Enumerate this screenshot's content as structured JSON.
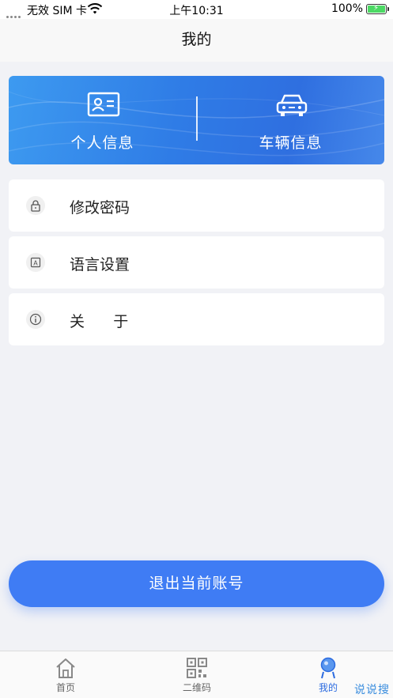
{
  "status_bar": {
    "carrier": "无效 SIM 卡",
    "time": "上午10:31",
    "battery": "100%"
  },
  "nav": {
    "title": "我的"
  },
  "hero": {
    "left_label": "个人信息",
    "right_label": "车辆信息"
  },
  "menu": [
    {
      "label": "修改密码",
      "icon": "lock-icon"
    },
    {
      "label": "语言设置",
      "icon": "language-icon"
    },
    {
      "label": "关      于",
      "icon": "info-icon"
    }
  ],
  "logout_label": "退出当前账号",
  "tabs": [
    {
      "label": "首页",
      "icon": "home-icon"
    },
    {
      "label": "二维码",
      "icon": "qrcode-icon"
    },
    {
      "label": "我的",
      "icon": "profile-icon",
      "active": true
    }
  ],
  "watermark": "说说搜",
  "colors": {
    "accent": "#3f7cf4",
    "hero_start": "#3d9af0",
    "hero_end": "#2f6fe0",
    "battery": "#4cd964",
    "tab_active": "#2c6be0"
  }
}
